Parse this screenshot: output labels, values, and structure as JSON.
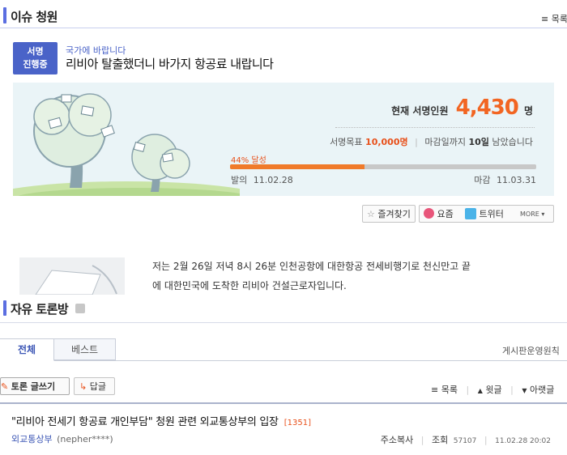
{
  "issue": {
    "section_title": "이슈 청원",
    "more_label": "목록"
  },
  "petition": {
    "badge_line1": "서명",
    "badge_line2": "진행중",
    "category": "국가에 바랍니다",
    "title": "리비아 탈출했더니 바가지 항공료 내랍니다",
    "current_label": "현재 서명인원",
    "current_count": "4,430",
    "current_unit": "명",
    "goal_label": "서명목표",
    "goal_value": "10,000명",
    "deadline_prefix": "마감일까지",
    "deadline_days": "10일",
    "deadline_suffix": "남았습니다",
    "progress_percent": 44,
    "progress_text": "44% 달성",
    "start_label": "발의",
    "start_date": "11.02.28",
    "end_label": "마감",
    "end_date": "11.03.31",
    "body_line1": "저는 2월 26일 저녁 8시 26분 인천공항에 대한항공 전세비행기로 천신만고 끝",
    "body_line2": "에 대한민국에 도착한 리비아 건설근로자입니다."
  },
  "share": {
    "bookmark": "즐겨찾기",
    "yozm": "요즘",
    "twitter": "트위터",
    "more": "MORE"
  },
  "forum": {
    "section_title": "자유 토론방",
    "tabs": [
      "전체",
      "베스트"
    ],
    "rules_link": "게시판운영원칙",
    "write_button": "토론 글쓰기",
    "reply_button": "답글",
    "list_link": "목록",
    "prev_link": "윗글",
    "next_link": "아랫글",
    "post_title": "\"리비아 전세기 항공료 개인부담\" 청원 관련 외교통상부의 입장",
    "comment_count": "[1351]",
    "author": "외교통상부",
    "author_id": "(nepher****)",
    "copy_url": "주소복사",
    "views_label": "조회",
    "views": "57107",
    "date": "11.02.28 20:02"
  },
  "colors": {
    "accent": "#4a63c8",
    "orange": "#f26522",
    "box_bg": "#eaf4f7"
  }
}
